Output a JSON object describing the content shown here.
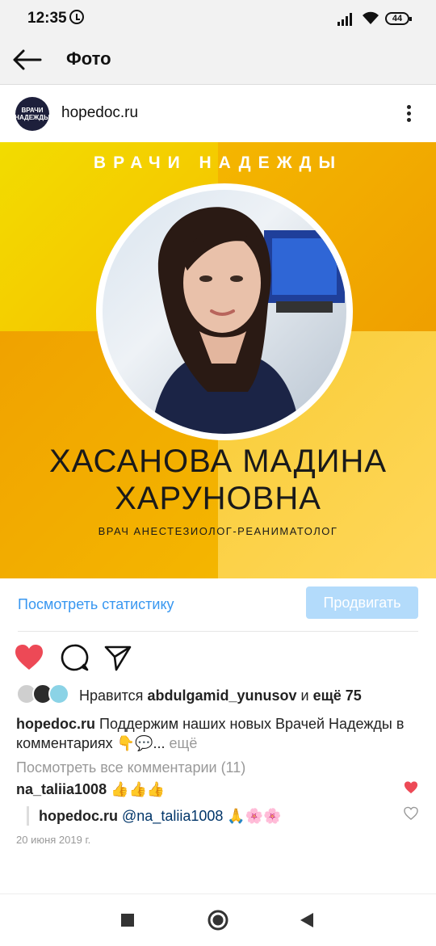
{
  "status_bar": {
    "time": "12:35",
    "battery": "44"
  },
  "app_bar": {
    "title": "Фото"
  },
  "post": {
    "avatar_text": "ВРАЧИ НАДЕЖДЫ",
    "username": "hopedoc.ru",
    "image": {
      "brand": "ВРАЧИ НАДЕЖДЫ",
      "name_line1": "ХАСАНОВА МАДИНА",
      "name_line2": "ХАРУНОВНА",
      "role": "ВРАЧ АНЕСТЕЗИОЛОГ-РЕАНИМАТОЛОГ"
    },
    "stats_link": "Посмотреть статистику",
    "promote_button": "Продвигать",
    "likes": {
      "prefix": "Нравится",
      "user": "abdulgamid_yunusov",
      "joiner": "и",
      "others": "ещё 75"
    },
    "caption": {
      "user": "hopedoc.ru",
      "text": "Поддержим наших новых Врачей Надежды в комментариях 👇💬...",
      "more": "ещё"
    },
    "view_all_comments": "Посмотреть все комментарии (11)",
    "comments": [
      {
        "user": "na_taliia1008",
        "text": "👍👍👍",
        "liked": true
      },
      {
        "user": "hopedoc.ru",
        "mention": "@na_taliia1008",
        "text": "🙏🌸🌸",
        "liked": false
      }
    ],
    "date": "20 июня 2019 г."
  },
  "colors": {
    "accent": "#3897f0",
    "like_red": "#ed4956",
    "promote_bg": "#b3dbfb",
    "yellow": "#f6c200",
    "orange": "#f0a200"
  },
  "icons": [
    "back-arrow-icon",
    "more-vert-icon",
    "heart-icon",
    "comment-icon",
    "share-icon",
    "nav-square-icon",
    "nav-home-icon",
    "nav-back-icon"
  ]
}
